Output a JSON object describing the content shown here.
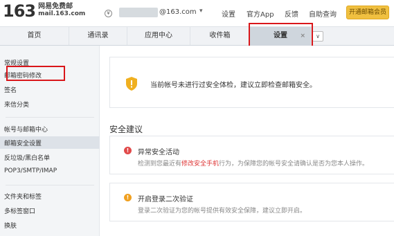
{
  "header": {
    "logo_number": "163",
    "logo_name": "网易免费邮",
    "logo_domain": "mail.163.com",
    "coin_icon": "¥",
    "email_suffix": "@163.com",
    "links": [
      "设置",
      "官方App",
      "反馈",
      "自助查询"
    ],
    "vip_button": "开通邮箱会员"
  },
  "nav": {
    "tabs": [
      "首页",
      "通讯录",
      "应用中心",
      "收件箱",
      "设置"
    ],
    "active_tab": "设置",
    "close_glyph": "×",
    "more_glyph": "∨"
  },
  "sidebar": {
    "group1": [
      "常规设置",
      "邮箱密码修改",
      "签名",
      "来信分类"
    ],
    "group2": [
      "帐号与邮箱中心",
      "邮箱安全设置",
      "反垃圾/黑白名单",
      "POP3/SMTP/IMAP"
    ],
    "group3": [
      "文件夹和标签",
      "多标签窗口",
      "换肤"
    ],
    "active_item": "邮箱安全设置"
  },
  "main": {
    "notice_text": "当前帐号未进行过安全体检，建议立即检查邮箱安全。",
    "section_title": "安全建议",
    "cards": [
      {
        "title": "异常安全活动",
        "desc_before": "检测到您最近有",
        "desc_highlight": "修改安全手机",
        "desc_after": "行为，为保障您的帐号安全请确认是否为您本人操作。",
        "icon_glyph": "!",
        "icon_color": "#e14a4a"
      },
      {
        "title": "开启登录二次验证",
        "desc_before": "登录二次验证为您的帐号提供有效安全保障，建议立即开启。",
        "desc_highlight": "",
        "desc_after": "",
        "icon_glyph": "!",
        "icon_color": "#f0a020"
      }
    ]
  },
  "colors": {
    "highlight_red": "#d9161a",
    "vip_gold": "#f0c040",
    "shield_gold": "#f0b020"
  }
}
